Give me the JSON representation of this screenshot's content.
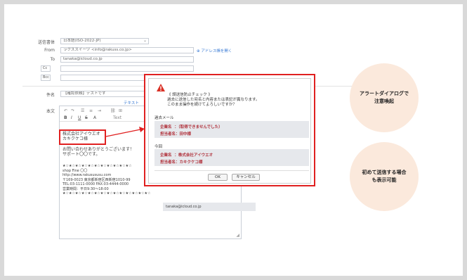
{
  "form": {
    "encoding_label": "送信書体",
    "encoding_value": "日本語(ISO-2022-JP)",
    "from_label": "From",
    "from_value": "ラクススイーツ <info@rakuss.co.jp>",
    "address_book_link": "アドレス帳を開く",
    "to_label": "To",
    "to_value": "tanaka@icloud.co.jp",
    "cc_label": "Cc",
    "bcc_label": "Bcc",
    "subject_label": "件名",
    "subject_value": "【確認依頼】テストです",
    "body_label": "本文",
    "text_link": "テキスト"
  },
  "editor": {
    "toolbar_text_label": "Text",
    "lines_name": [
      "株式会社アイウエオ",
      "カキクケコ様"
    ],
    "lines_greeting": [
      "お問い合わせありがとうございます！",
      "サポート〇〇です。"
    ],
    "signature_lines": [
      "★☆★☆★☆★☆★☆★☆★☆★☆★☆★☆★☆",
      "shop Fine 〇〇",
      "http://www.rakusususu.com",
      "〒169-0023  東京都新宿区西新宿1010-99",
      "TEL:03-1111-0000  FAX:03-4444-0000",
      "営業時間：平日9:30～18:00",
      "★☆★☆★☆★☆★☆★☆★☆★☆★☆★☆★☆★☆★☆★☆"
    ]
  },
  "dialog": {
    "title": "《 誤送信防止チェック 》",
    "message_1": "過去に送信した宛名と内容または表記が異なります。",
    "message_2": "このまま操作を続けてよろしいですか？",
    "past_label": "過去メール",
    "past_company_label": "企業名",
    "past_company_value": "：（取得できませんでした）",
    "past_person_label": "担当者名：",
    "past_person_value": "田中様",
    "current_label": "今回",
    "current_company_label": "企業名",
    "current_company_value": "：株式会社アイウエオ",
    "current_person_label": "担当者名：",
    "current_person_value": "カキクケコ様",
    "ok_label": "OK",
    "cancel_label": "キャンセル"
  },
  "summary_email": "tanaka@icloud.co.jp",
  "callouts": {
    "top_line1": "アラートダイアログで",
    "top_line2": "注意喚起",
    "bottom_line1": "初めて送信する場合",
    "bottom_line2": "も表示可能"
  },
  "colors": {
    "alert_red": "#e02020",
    "emphasis_text": "#b0303a",
    "callout_bg": "#fbe9dc",
    "link_blue": "#3a7bd5"
  }
}
